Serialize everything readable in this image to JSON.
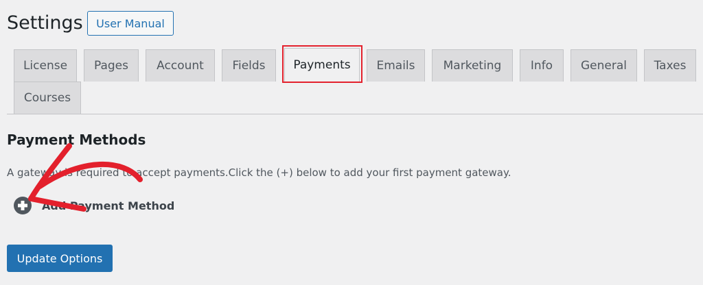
{
  "header": {
    "title": "Settings",
    "manual_button": "User Manual"
  },
  "tabs": [
    {
      "label": "License"
    },
    {
      "label": "Pages"
    },
    {
      "label": "Account"
    },
    {
      "label": "Fields"
    },
    {
      "label": "Payments",
      "active": true
    },
    {
      "label": "Emails"
    },
    {
      "label": "Marketing"
    },
    {
      "label": "Info"
    },
    {
      "label": "General"
    },
    {
      "label": "Taxes"
    },
    {
      "label": "Courses"
    }
  ],
  "section": {
    "title": "Payment Methods",
    "description": "A gateway is required to accept payments.Click the (+) below to add your first payment gateway.",
    "add_method_label": "Add Payment Method"
  },
  "footer": {
    "update_button": "Update Options"
  },
  "colors": {
    "primary": "#2271b1",
    "annotation_red": "#e3202c",
    "tab_background": "#dcdcde",
    "page_background": "#f0f0f1"
  },
  "icons": {
    "add": "plus-circle-icon"
  }
}
